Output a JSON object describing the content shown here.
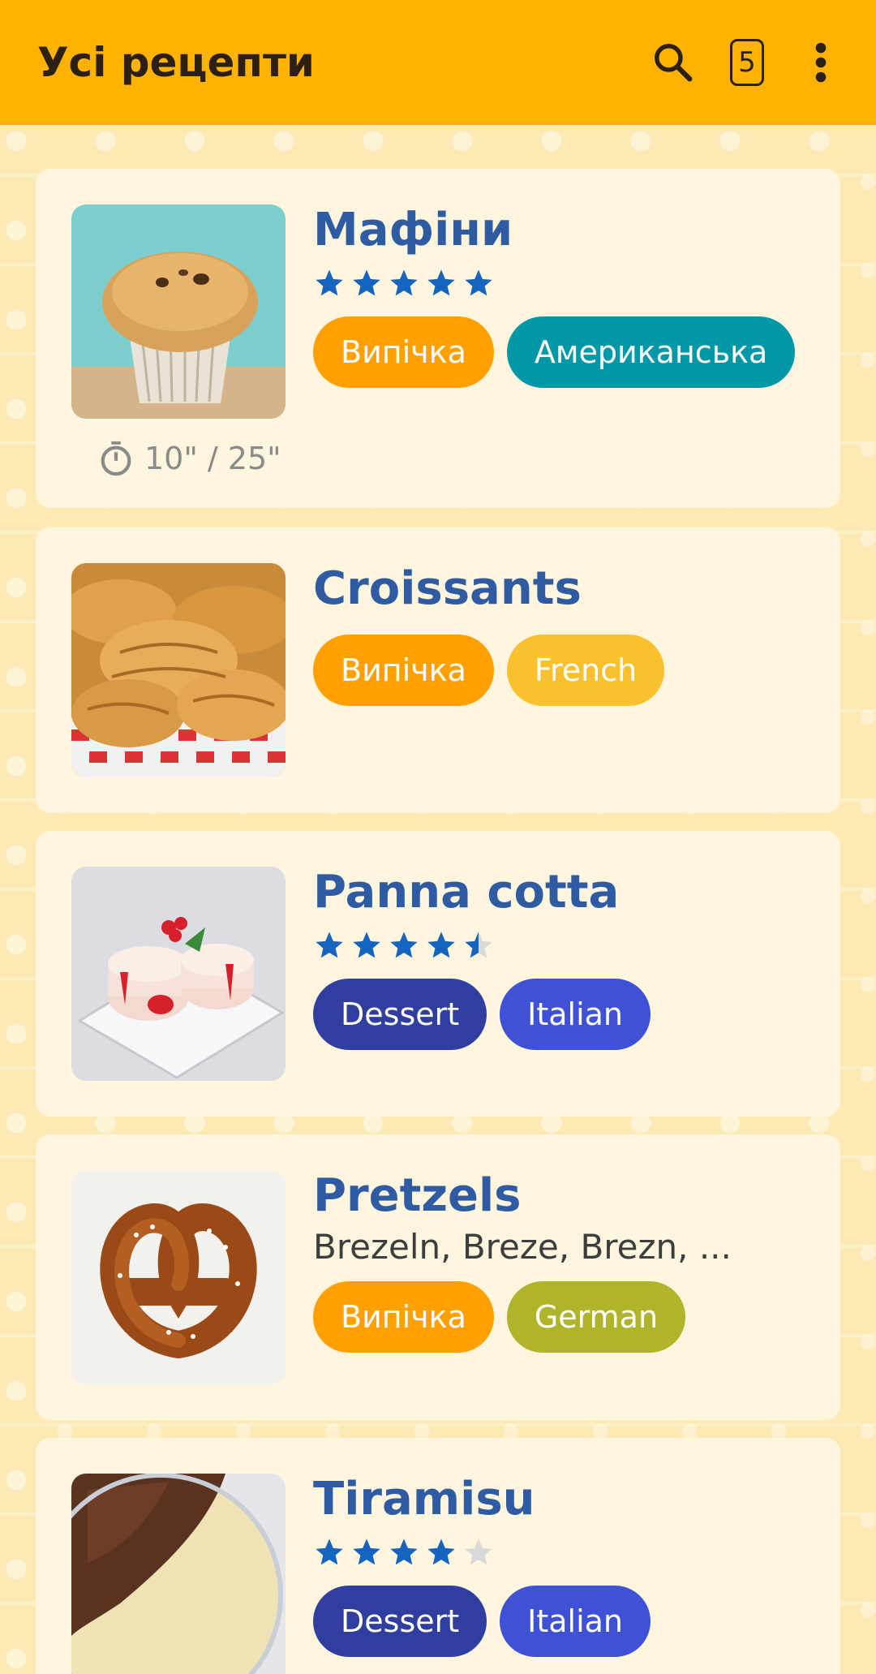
{
  "app_bar": {
    "title": "Усі рецепти",
    "badge_count": "5",
    "icons": [
      "search-icon",
      "list-count-badge",
      "more-vert-icon"
    ]
  },
  "colors": {
    "app_bar": "#FFB300",
    "title": "#2F5BA3",
    "star": "#1565C0",
    "star_empty": "#D9D9D9",
    "chip_pastry": "#FFA000",
    "chip_american": "#0097A7",
    "chip_french": "#FBC02D",
    "chip_dessert": "#303F9F",
    "chip_italian": "#3F51D5",
    "chip_german": "#AFB42B"
  },
  "recipes": [
    {
      "title": "Мафіни",
      "rating": 5,
      "tags": [
        {
          "label": "Випічка",
          "color": "#FFA000"
        },
        {
          "label": "Американська",
          "color": "#0097A7"
        }
      ],
      "time": "10\" / 25\"",
      "image": "muffin"
    },
    {
      "title": "Croissants",
      "rating": null,
      "tags": [
        {
          "label": "Випічка",
          "color": "#FFA000"
        },
        {
          "label": "French",
          "color": "#FBC02D"
        }
      ],
      "image": "croissants"
    },
    {
      "title": "Panna cotta",
      "rating": 4.5,
      "tags": [
        {
          "label": "Dessert",
          "color": "#303F9F"
        },
        {
          "label": "Italian",
          "color": "#3F51D5"
        }
      ],
      "image": "panna-cotta"
    },
    {
      "title": "Pretzels",
      "subtitle": "Brezeln, Breze, Brezn, ...",
      "rating": null,
      "tags": [
        {
          "label": "Випічка",
          "color": "#FFA000"
        },
        {
          "label": "German",
          "color": "#AFB42B"
        }
      ],
      "image": "pretzel"
    },
    {
      "title": "Tiramisu",
      "rating": 4,
      "tags": [
        {
          "label": "Dessert",
          "color": "#303F9F"
        },
        {
          "label": "Italian",
          "color": "#3F51D5"
        }
      ],
      "image": "tiramisu"
    }
  ]
}
